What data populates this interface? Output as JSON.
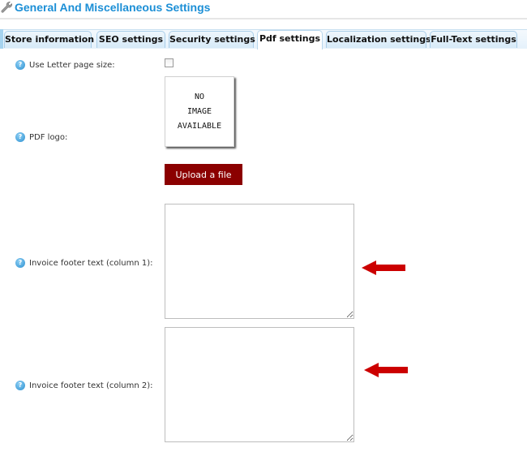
{
  "header": {
    "title": "General And Miscellaneous Settings",
    "icon": "wrench-icon",
    "title_color": "#1c8fd6"
  },
  "tabs": [
    {
      "label": "Store information",
      "active": false
    },
    {
      "label": "SEO settings",
      "active": false
    },
    {
      "label": "Security settings",
      "active": false
    },
    {
      "label": "Pdf settings",
      "active": true
    },
    {
      "label": "Localization settings",
      "active": false
    },
    {
      "label": "Full-Text settings",
      "active": false
    }
  ],
  "form": {
    "use_letter_page_size": {
      "label": "Use Letter page size:",
      "checked": false
    },
    "pdf_logo": {
      "label": "PDF logo:",
      "placeholder_lines": [
        "NO",
        "IMAGE",
        "AVAILABLE"
      ],
      "upload_label": "Upload a file",
      "upload_color": "#8b0000"
    },
    "invoice_footer_col1": {
      "label": "Invoice footer text (column 1):",
      "value": ""
    },
    "invoice_footer_col2": {
      "label": "Invoice footer text (column 2):",
      "value": ""
    }
  },
  "annotations": {
    "arrow_color": "#cc0000",
    "arrows": [
      "points-to-invoice-footer-col1",
      "points-to-invoice-footer-col2"
    ]
  }
}
